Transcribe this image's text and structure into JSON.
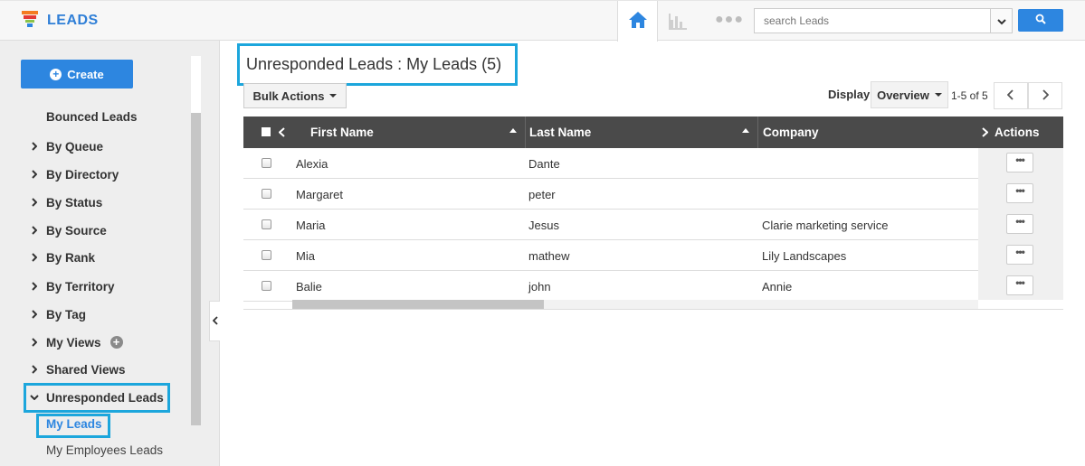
{
  "app": {
    "name": "LEADS",
    "brand_color": "#2f7fd7"
  },
  "topbar": {
    "home_icon": "home-icon",
    "reports_icon": "bar-chart-icon",
    "more_icon": "more-dots-icon",
    "search_placeholder": "search Leads",
    "search_button_icon": "search-icon"
  },
  "sidebar": {
    "create_label": "Create",
    "items": [
      {
        "label": "Bounced Leads",
        "expandable": false
      },
      {
        "label": "By Queue",
        "expandable": true
      },
      {
        "label": "By Directory",
        "expandable": true
      },
      {
        "label": "By Status",
        "expandable": true
      },
      {
        "label": "By Source",
        "expandable": true
      },
      {
        "label": "By Rank",
        "expandable": true
      },
      {
        "label": "By Territory",
        "expandable": true
      },
      {
        "label": "By Tag",
        "expandable": true
      },
      {
        "label": "My Views",
        "expandable": true
      },
      {
        "label": "Shared Views",
        "expandable": true
      },
      {
        "label": "Unresponded Leads",
        "expandable": true,
        "expanded": true
      }
    ],
    "sub_items": [
      {
        "label": "My Leads",
        "active": true
      },
      {
        "label": "My Employees Leads",
        "active": false
      }
    ]
  },
  "main": {
    "title": "Unresponded Leads : My Leads (5)",
    "bulk_actions_label": "Bulk Actions",
    "display_label": "Display",
    "display_value": "Overview",
    "page_count": "1-5 of 5"
  },
  "table": {
    "columns": [
      "First Name",
      "Last Name",
      "Company",
      "Actions"
    ],
    "rows": [
      {
        "first": "Alexia",
        "last": "Dante",
        "company": ""
      },
      {
        "first": "Margaret",
        "last": "peter",
        "company": ""
      },
      {
        "first": "Maria",
        "last": "Jesus",
        "company": "Clarie marketing service"
      },
      {
        "first": "Mia",
        "last": "mathew",
        "company": "Lily Landscapes"
      },
      {
        "first": "Balie",
        "last": "john",
        "company": "Annie"
      }
    ],
    "row_action_label": "•••"
  },
  "colors": {
    "accent": "#2d86e0",
    "highlight": "#1ca6dc",
    "header_bg": "#4a4a4a"
  }
}
